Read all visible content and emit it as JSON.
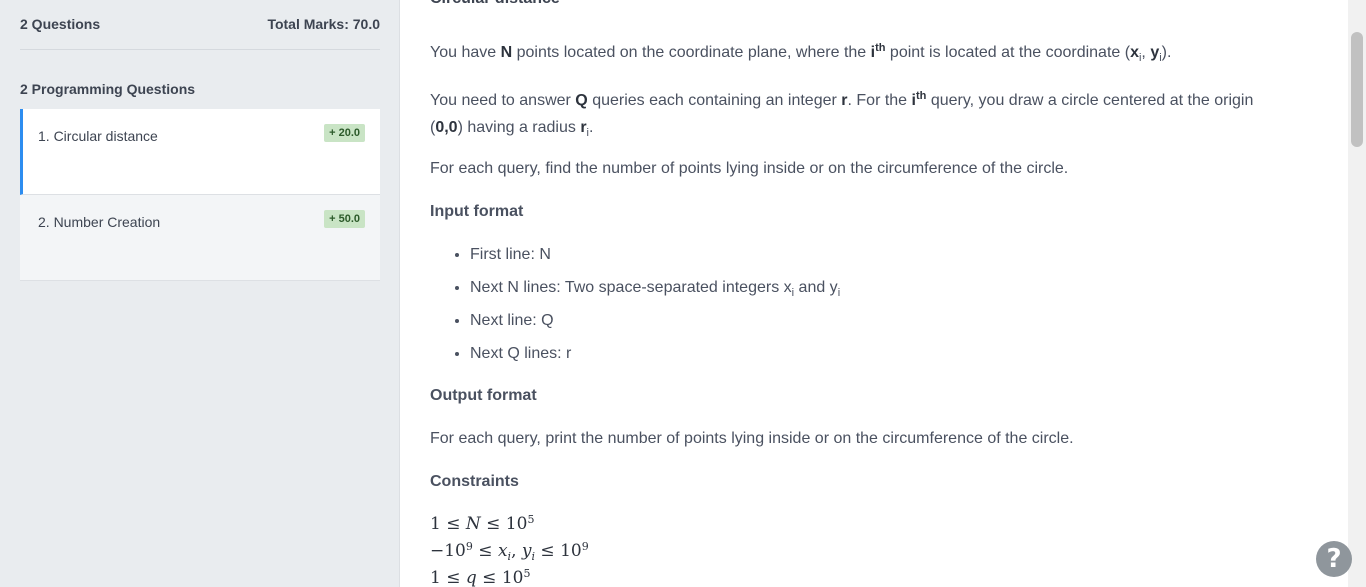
{
  "sidebar": {
    "questions_count": "2 Questions",
    "total_marks": "Total Marks: 70.0",
    "section_title": "2 Programming Questions",
    "items": [
      {
        "title": "1. Circular distance",
        "badge": "+ 20.0",
        "active": true
      },
      {
        "title": "2. Number Creation",
        "badge": "+ 50.0",
        "active": false
      }
    ]
  },
  "problem": {
    "title": "Circular distance",
    "p1": {
      "a": "You have ",
      "b": "N",
      "c": " points located on the coordinate plane, where the ",
      "d": "i",
      "sup": "th",
      "e": " point is located at the coordinate (",
      "f": "x",
      "fsub": "i",
      "g": ", ",
      "h": "y",
      "hsub": "i",
      "j": ")."
    },
    "p2": {
      "a": "You need to answer ",
      "b": "Q",
      "c": " queries each containing an integer ",
      "d": "r",
      "e": ". For the ",
      "f": "i",
      "sup": "th",
      "g": " query, you draw a circle centered at the origin",
      "h": "(",
      "i2": "0,0",
      "j": ") having a radius ",
      "k": "r",
      "ksub": "i",
      "l": "."
    },
    "p3": "For each query, find the number of points lying inside or on the circumference of the circle.",
    "input_heading": "Input format",
    "input_items": [
      {
        "text": "First line: N"
      },
      {
        "text": "Next N lines: Two space-separated integers x",
        "sub1": "i",
        "mid": " and y",
        "sub2": "i"
      },
      {
        "text": "Next line: Q"
      },
      {
        "text": "Next Q lines: r"
      }
    ],
    "output_heading": "Output format",
    "output_text": "For each query, print the number of points lying inside or on the circumference of the circle.",
    "constraints_heading": "Constraints",
    "constraints": [
      {
        "pre": "1 ≤ ",
        "var": "N",
        "post": " ≤ 10",
        "exp": "5"
      },
      {
        "pre": "−10",
        "preexp": "9",
        "mid": " ≤ ",
        "var": "x",
        "sub1": "i",
        "comma": ", ",
        "var2": "y",
        "sub2": "i",
        "post": " ≤ 10",
        "exp": "9"
      },
      {
        "pre": "1 ≤ ",
        "var": "q",
        "post": " ≤ 10",
        "exp": "5"
      }
    ]
  },
  "help": {
    "label": "?"
  }
}
